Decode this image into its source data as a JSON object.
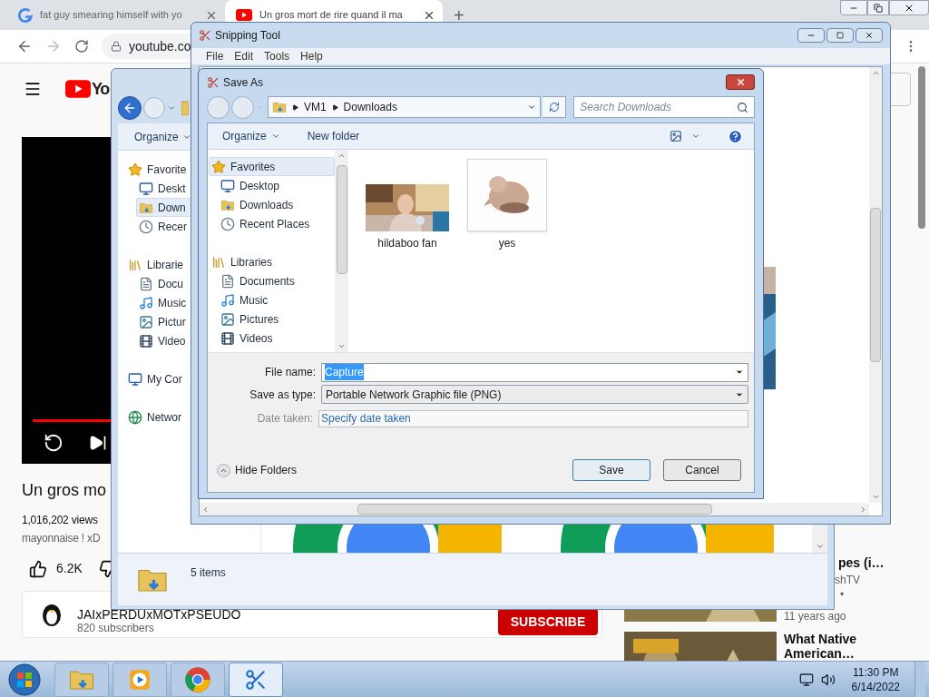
{
  "browser": {
    "tabs": [
      {
        "title": "fat guy smearing himself with yo",
        "kind": "google",
        "selected": false
      },
      {
        "title": "Un gros mort de rire quand il ma",
        "kind": "youtube",
        "selected": true
      }
    ],
    "new_tab": "+",
    "url": "youtube.co"
  },
  "youtube": {
    "logo": "Yo",
    "video_title": "Un gros mo",
    "views": "1,016,202 views",
    "description": "mayonnaise ! xD",
    "likes": "6.2K",
    "channel": {
      "name": "JAIxPERDUxMOTxPSEUDO",
      "subscribers": "820 subscribers"
    },
    "subscribe": "SUBSCRIBE",
    "related": [
      {
        "title": "pes (i…",
        "channel": "shTV",
        "dot": "•",
        "age": "11 years ago"
      },
      {
        "title": "What Native American…"
      }
    ]
  },
  "explorer": {
    "organize": "Organize",
    "nav": [
      {
        "label": "Favorite",
        "kind": "star",
        "selected": false,
        "children": [
          {
            "label": "Deskt",
            "kind": "desktop",
            "selected": false
          },
          {
            "label": "Down",
            "kind": "downloads",
            "selected": true
          },
          {
            "label": "Recer",
            "kind": "recent",
            "selected": false
          }
        ]
      },
      {
        "label": "Librarie",
        "kind": "libraries",
        "selected": false,
        "children": [
          {
            "label": "Docu",
            "kind": "documents",
            "selected": false
          },
          {
            "label": "Music",
            "kind": "music",
            "selected": false
          },
          {
            "label": "Pictur",
            "kind": "pictures",
            "selected": false
          },
          {
            "label": "Video",
            "kind": "videos",
            "selected": false
          }
        ]
      },
      {
        "label": "My Cor",
        "kind": "computer",
        "selected": false
      },
      {
        "label": "Networ",
        "kind": "network",
        "selected": false
      }
    ],
    "status": "5 items"
  },
  "snipping_tool": {
    "title": "Snipping Tool",
    "menu": [
      "File",
      "Edit",
      "Tools",
      "Help"
    ]
  },
  "save_as": {
    "title": "Save As",
    "path": [
      "VM1",
      "Downloads"
    ],
    "search_placeholder": "Search Downloads",
    "organize": "Organize",
    "new_folder": "New folder",
    "nav": [
      {
        "label": "Favorites",
        "kind": "star",
        "selected": true,
        "children": [
          {
            "label": "Desktop",
            "kind": "desktop",
            "selected": false
          },
          {
            "label": "Downloads",
            "kind": "downloads",
            "selected": false
          },
          {
            "label": "Recent Places",
            "kind": "recent",
            "selected": false
          }
        ]
      },
      {
        "label": "Libraries",
        "kind": "libraries",
        "selected": false,
        "children": [
          {
            "label": "Documents",
            "kind": "documents",
            "selected": false
          },
          {
            "label": "Music",
            "kind": "music",
            "selected": false
          },
          {
            "label": "Pictures",
            "kind": "pictures",
            "selected": false
          },
          {
            "label": "Videos",
            "kind": "videos",
            "selected": false
          }
        ]
      }
    ],
    "files": [
      {
        "name": "hildaboo fan",
        "kind": "video"
      },
      {
        "name": "yes"
      }
    ],
    "file_name": {
      "label": "File name:",
      "value": "Capture",
      "text_selected": true
    },
    "save_type": {
      "label": "Save as type:",
      "value": "Portable Network Graphic file (PNG)"
    },
    "date_taken": {
      "label": "Date taken:",
      "value": "Specify date taken"
    },
    "hide_folders": "Hide Folders",
    "save": "Save",
    "cancel": "Cancel"
  },
  "taskbar": {
    "apps": [
      {
        "kind": "explorer",
        "selected": false
      },
      {
        "kind": "media",
        "selected": false
      },
      {
        "kind": "chrome",
        "selected": false
      },
      {
        "kind": "snipping",
        "selected": true
      }
    ],
    "time": "11:30 PM",
    "date": "6/14/2022"
  }
}
